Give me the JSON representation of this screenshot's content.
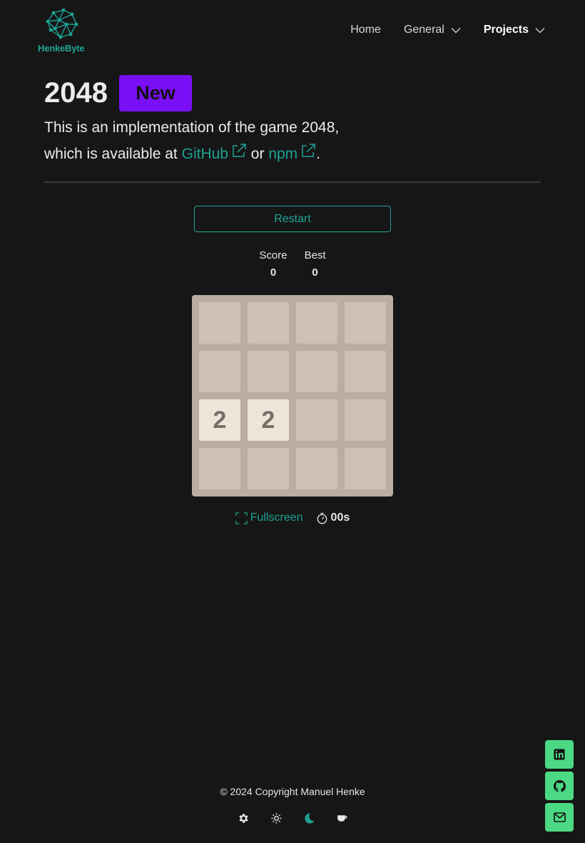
{
  "brand": {
    "name": "HenkeByte",
    "logo_color": "#1ea395"
  },
  "nav": {
    "items": [
      {
        "label": "Home",
        "has_dropdown": false,
        "active": false
      },
      {
        "label": "General",
        "has_dropdown": true,
        "active": false
      },
      {
        "label": "Projects",
        "has_dropdown": true,
        "active": true
      }
    ]
  },
  "page": {
    "title": "2048",
    "badge": "New",
    "badge_color": "#7a0ff5",
    "description_line1": "This is an implementation of the game 2048,",
    "description_prefix": "which is available at ",
    "link_github": "GitHub",
    "link_or": " or ",
    "link_npm": "npm",
    "description_suffix": "."
  },
  "game": {
    "restart_label": "Restart",
    "score_label": "Score",
    "score_value": "0",
    "best_label": "Best",
    "best_value": "0",
    "grid": [
      [
        null,
        null,
        null,
        null
      ],
      [
        null,
        null,
        null,
        null
      ],
      [
        "2",
        "2",
        null,
        null
      ],
      [
        null,
        null,
        null,
        null
      ]
    ],
    "fullscreen_label": "Fullscreen",
    "timer_value": "00s"
  },
  "footer": {
    "copyright": "© 2024 Copyright Manuel Henke",
    "theme_buttons": [
      "gear-icon",
      "sun-icon",
      "moon-icon",
      "coffee-icon"
    ],
    "active_theme": "moon-icon"
  },
  "social": [
    "linkedin-icon",
    "github-icon",
    "mail-icon"
  ],
  "colors": {
    "accent": "#1ea395",
    "social_bg": "#4cd984",
    "background": "#161616"
  }
}
